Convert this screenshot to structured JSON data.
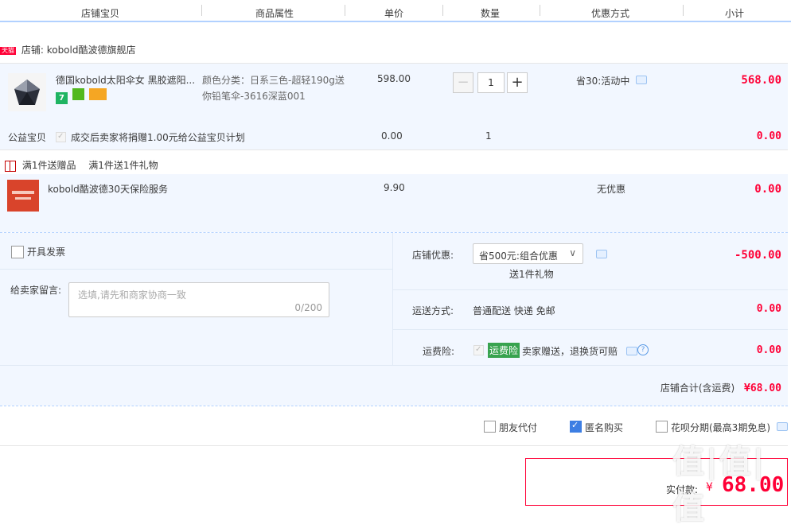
{
  "header": {
    "col_item": "店铺宝贝",
    "col_props": "商品属性",
    "col_price": "单价",
    "col_qty": "数量",
    "col_discount": "优惠方式",
    "col_subtotal": "小计"
  },
  "shop": {
    "badge": "天猫",
    "label": "店铺:",
    "name": "kobold酷波德旗舰店"
  },
  "item": {
    "title": "德国kobold太阳伞女 黑胶遮阳...",
    "props_line1": "颜色分类：日系三色-超轻190g送",
    "props_line2": "你铅笔伞-3616深蓝001",
    "price": "598.00",
    "qty": "1",
    "qty_minus": "−",
    "qty_plus": "+",
    "discount": "省30:活动中",
    "subtotal": "568.00",
    "badge_colors": [
      "#1fb462",
      "#52b81e",
      "#f5a623"
    ]
  },
  "charity": {
    "label": "公益宝贝",
    "text": "成交后卖家将捐赠1.00元给公益宝贝计划",
    "price": "0.00",
    "qty": "1",
    "subtotal": "0.00"
  },
  "gift": {
    "label": "满1件送赠品",
    "text": "满1件送1件礼物"
  },
  "insurance_item": {
    "title": "kobold酷波德30天保险服务",
    "price": "9.90",
    "discount": "无优惠",
    "subtotal": "0.00"
  },
  "invoice": {
    "label": "开具发票"
  },
  "message": {
    "label": "给卖家留言:",
    "placeholder": "选填,请先和商家协商一致",
    "counter": "0/200"
  },
  "shop_discount": {
    "label": "店铺优惠:",
    "selected": "省500元:组合优惠",
    "gift_note": "送1件礼物",
    "amount": "-500.00"
  },
  "shipping": {
    "label": "运送方式:",
    "value": "普通配送 快递 免邮",
    "amount": "0.00"
  },
  "freight_insurance": {
    "label": "运费险:",
    "tag": "运费险",
    "text": "卖家赠送，退换货可赔",
    "amount": "0.00"
  },
  "shop_total": {
    "label": "店铺合计(含运费)",
    "amount": "¥68.00"
  },
  "options": {
    "friend_pay": "朋友代付",
    "anonymous": "匿名购买",
    "huabei": "花呗分期(最高3期免息)"
  },
  "payment": {
    "label": "实付款:",
    "currency": "¥",
    "amount": "68.00"
  },
  "watermark": "值|值|值",
  "colors": {
    "accent_red": "#ff0036",
    "header_line": "#b2d1ff",
    "light_blue_bg": "#f2f7ff",
    "check_blue": "#3d7ee3",
    "freight_tag": "#38a34f"
  }
}
